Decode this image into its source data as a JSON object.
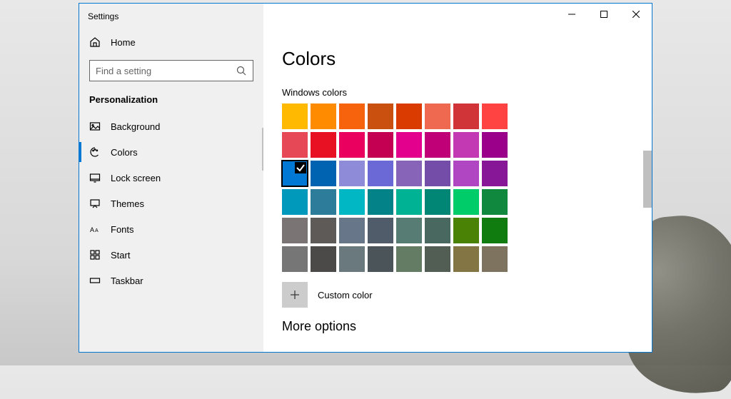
{
  "window": {
    "title": "Settings"
  },
  "home_label": "Home",
  "search": {
    "placeholder": "Find a setting"
  },
  "section_title": "Personalization",
  "nav": [
    {
      "id": "background",
      "label": "Background",
      "icon": "picture"
    },
    {
      "id": "colors",
      "label": "Colors",
      "icon": "palette",
      "active": true
    },
    {
      "id": "lockscreen",
      "label": "Lock screen",
      "icon": "monitor"
    },
    {
      "id": "themes",
      "label": "Themes",
      "icon": "themes"
    },
    {
      "id": "fonts",
      "label": "Fonts",
      "icon": "fonts"
    },
    {
      "id": "start",
      "label": "Start",
      "icon": "start"
    },
    {
      "id": "taskbar",
      "label": "Taskbar",
      "icon": "taskbar"
    }
  ],
  "page": {
    "title": "Colors",
    "windows_colors_label": "Windows colors",
    "custom_color_label": "Custom color",
    "more_options_label": "More options"
  },
  "colors": {
    "selected_index": 16,
    "swatches": [
      "#ffb900",
      "#ff8c00",
      "#f7630c",
      "#ca5010",
      "#da3b01",
      "#ef6950",
      "#d13438",
      "#ff4343",
      "#e74856",
      "#e81123",
      "#ea005e",
      "#c30052",
      "#e3008c",
      "#bf0077",
      "#c239b3",
      "#9a0089",
      "#0078d4",
      "#0063b1",
      "#8e8cd8",
      "#6b69d6",
      "#8764b8",
      "#744da9",
      "#b146c2",
      "#881798",
      "#0099bc",
      "#2d7d9a",
      "#00b7c3",
      "#038387",
      "#00b294",
      "#018574",
      "#00cc6a",
      "#10893e",
      "#7a7574",
      "#5d5a58",
      "#68768a",
      "#515c6b",
      "#567c73",
      "#486860",
      "#498205",
      "#107c10",
      "#767676",
      "#4c4a48",
      "#69797e",
      "#4a5459",
      "#647c64",
      "#525e54",
      "#847545",
      "#7e735f"
    ]
  }
}
